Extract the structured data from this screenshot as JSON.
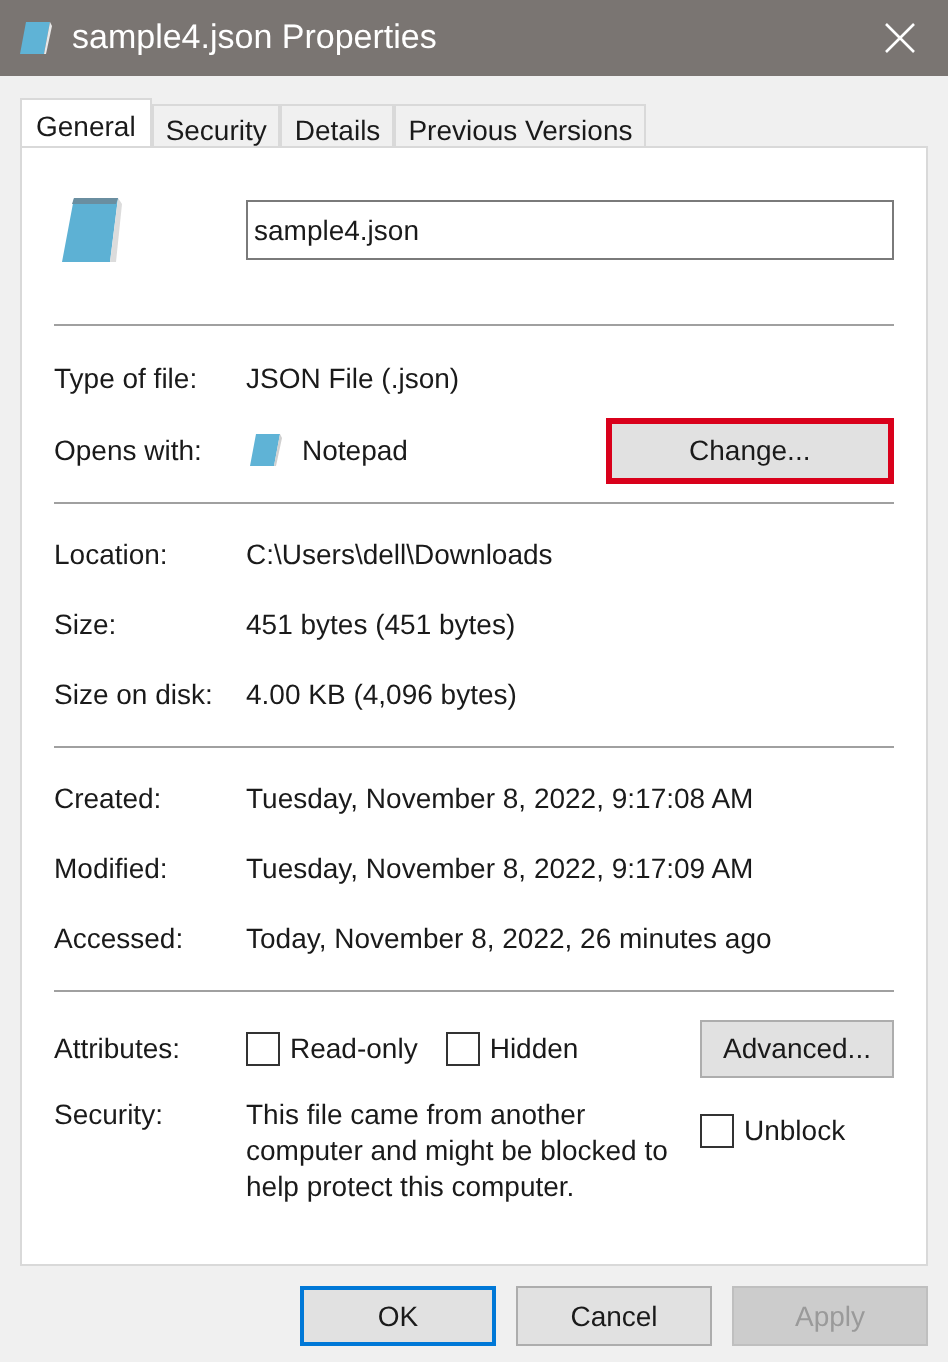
{
  "window": {
    "title": "sample4.json Properties"
  },
  "tabs": [
    {
      "label": "General",
      "selected": true
    },
    {
      "label": "Security",
      "selected": false
    },
    {
      "label": "Details",
      "selected": false
    },
    {
      "label": "Previous Versions",
      "selected": false
    }
  ],
  "file_name": {
    "value": "sample4.json"
  },
  "type_section": [
    {
      "label": "Type of file:",
      "value": "JSON File (.json)"
    },
    {
      "label": "Opens with:",
      "value": "Notepad",
      "button": {
        "label": "Change...",
        "highlighted": true
      }
    }
  ],
  "location_section": [
    {
      "label": "Location:",
      "value": "C:\\Users\\dell\\Downloads"
    },
    {
      "label": "Size:",
      "value": "451 bytes (451 bytes)"
    },
    {
      "label": "Size on disk:",
      "value": "4.00 KB (4,096 bytes)"
    }
  ],
  "dates_section": [
    {
      "label": "Created:",
      "value": "Tuesday, November 8, 2022, 9:17:08 AM"
    },
    {
      "label": "Modified:",
      "value": "Tuesday, November 8, 2022, 9:17:09 AM"
    },
    {
      "label": "Accessed:",
      "value": "Today, November 8, 2022, 26 minutes ago"
    }
  ],
  "attributes": {
    "label": "Attributes:",
    "checkboxes": [
      {
        "label": "Read-only",
        "checked": false
      },
      {
        "label": "Hidden",
        "checked": false
      }
    ],
    "button": "Advanced..."
  },
  "security": {
    "label": "Security:",
    "text": "This file came from another computer and might be blocked to help protect this computer.",
    "unblock": {
      "label": "Unblock",
      "checked": false
    }
  },
  "buttons": [
    {
      "label": "OK",
      "default": true,
      "disabled": false
    },
    {
      "label": "Cancel",
      "default": false,
      "disabled": false
    },
    {
      "label": "Apply",
      "default": false,
      "disabled": true
    }
  ]
}
